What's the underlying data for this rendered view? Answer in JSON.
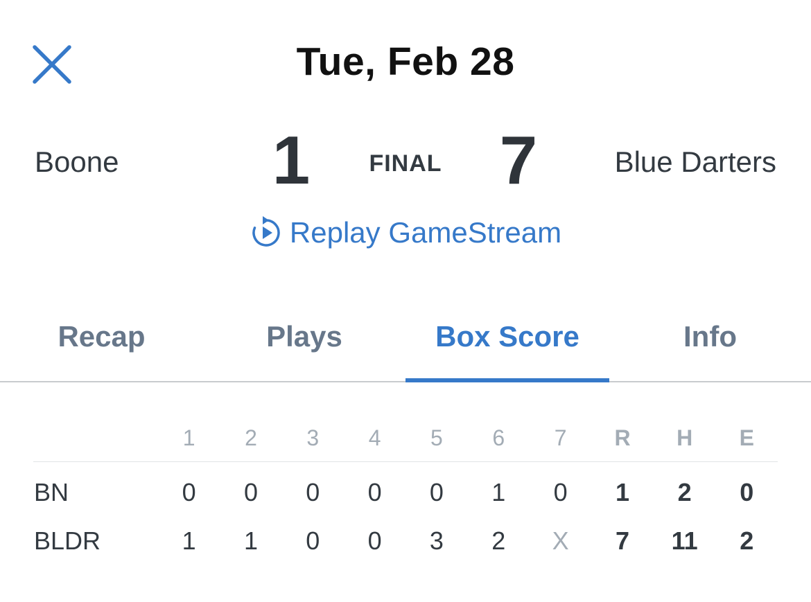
{
  "header": {
    "date": "Tue, Feb 28"
  },
  "game": {
    "home_team": "Boone",
    "away_team": "Blue Darters",
    "home_score": "1",
    "away_score": "7",
    "status": "FINAL",
    "replay_label": "Replay GameStream"
  },
  "tabs": [
    {
      "label": "Recap"
    },
    {
      "label": "Plays"
    },
    {
      "label": "Box Score"
    },
    {
      "label": "Info"
    }
  ],
  "active_tab": "Box Score",
  "box_score": {
    "headers": [
      "1",
      "2",
      "3",
      "4",
      "5",
      "6",
      "7",
      "R",
      "H",
      "E"
    ],
    "rows": [
      {
        "team": "BN",
        "innings": [
          "0",
          "0",
          "0",
          "0",
          "0",
          "1",
          "0"
        ],
        "r": "1",
        "h": "2",
        "e": "0"
      },
      {
        "team": "BLDR",
        "innings": [
          "1",
          "1",
          "0",
          "0",
          "3",
          "2",
          "X"
        ],
        "r": "7",
        "h": "11",
        "e": "2"
      }
    ]
  },
  "colors": {
    "accent": "#3679c9",
    "tab_inactive": "#67778a",
    "text": "#333a41",
    "muted": "#a3acb5"
  },
  "icons": {
    "close": "close-icon",
    "replay": "replay-icon"
  }
}
